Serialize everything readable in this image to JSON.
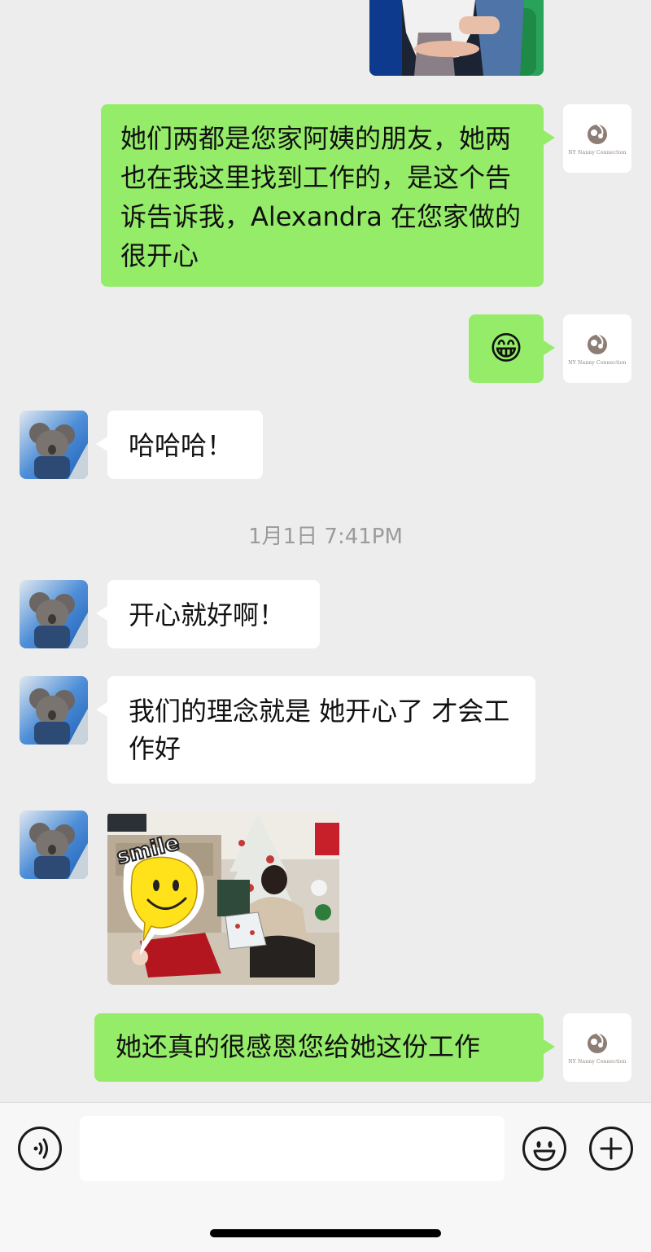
{
  "messages": [
    {
      "side": "outgoing",
      "kind": "image",
      "desc": "photo-top-partial"
    },
    {
      "side": "outgoing",
      "kind": "text",
      "text": "她们两都是您家阿姨的朋友，她两也在我这里找到工作的，是这个告诉告诉我，Alexandra 在您家做的很开心"
    },
    {
      "side": "outgoing",
      "kind": "emoji",
      "emoji": "😁"
    },
    {
      "side": "incoming",
      "kind": "text",
      "text": "哈哈哈！"
    },
    {
      "side": "incoming",
      "kind": "text",
      "text": "开心就好啊！"
    },
    {
      "side": "incoming",
      "kind": "text",
      "text": "我们的理念就是 她开心了 才会工作好"
    },
    {
      "side": "incoming",
      "kind": "image",
      "desc": "photo-christmas-gift",
      "sticker_text": "smile"
    },
    {
      "side": "outgoing",
      "kind": "text",
      "text": "她还真的很感恩您给她这份工作"
    }
  ],
  "timestamp": "1月1日 7:41PM",
  "brand_avatar_text": "NY Nanny Connection",
  "input": {
    "value": ""
  },
  "icons": {
    "voice": "voice-icon",
    "emoji": "emoji-icon",
    "more": "plus-icon"
  },
  "colors": {
    "background": "#ededed",
    "outgoing_bubble": "#95ec69",
    "incoming_bubble": "#ffffff",
    "timestamp": "#9b9b9b"
  }
}
